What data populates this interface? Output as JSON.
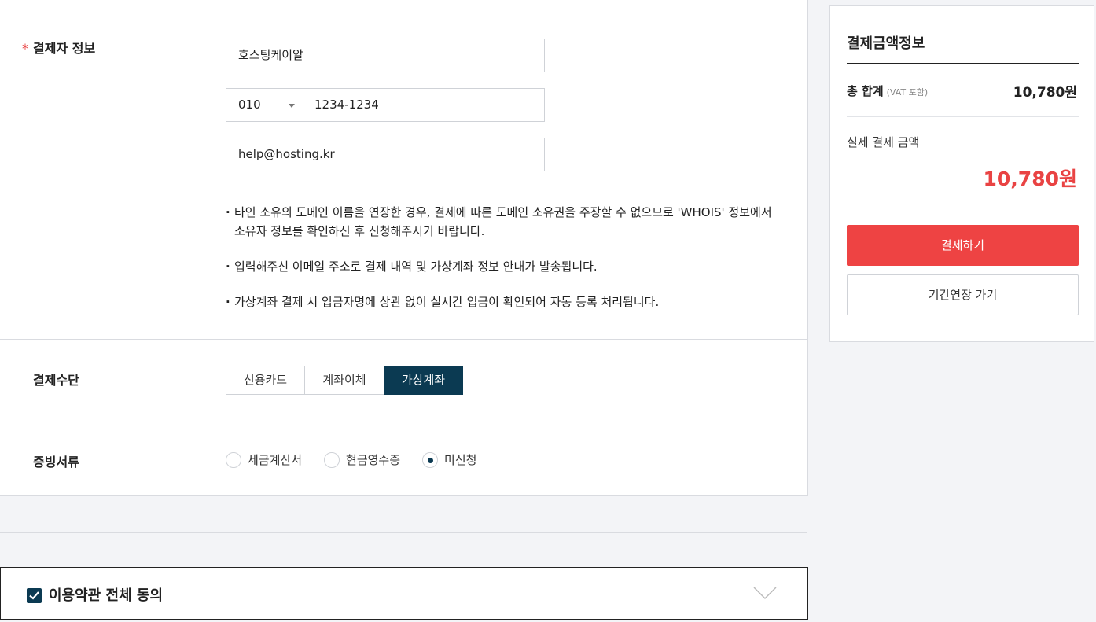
{
  "payer": {
    "label": "결제자 정보",
    "required_mark": "*",
    "name_value": "호스팅케이알",
    "phone_prefix": "010",
    "phone_number": "1234-1234",
    "email_value": "help@hosting.kr",
    "notes": [
      "타인 소유의 도메인 이름을 연장한 경우, 결제에 따른 도메인 소유권을 주장할 수 없으므로 'WHOIS' 정보에서 소유자 정보를 확인하신 후 신청해주시기 바랍니다.",
      "입력해주신 이메일 주소로 결제 내역 및 가상계좌 정보 안내가 발송됩니다.",
      "가상계좌 결제 시 입금자명에 상관 없이 실시간 입금이 확인되어 자동 등록 처리됩니다."
    ]
  },
  "method": {
    "label": "결제수단",
    "options": [
      "신용카드",
      "계좌이체",
      "가상계좌"
    ],
    "selected": "가상계좌"
  },
  "proof": {
    "label": "증빙서류",
    "options": [
      "세금계산서",
      "현금영수증",
      "미신청"
    ],
    "selected": "미신청"
  },
  "terms": {
    "label": "이용약관 전체 동의",
    "checked": true
  },
  "summary": {
    "title": "결제금액정보",
    "total_label": "총 합계",
    "vat_note": "(VAT 포함)",
    "total_value": "10,780원",
    "actual_label": "실제 결제 금액",
    "actual_value": "10,780원",
    "pay_button": "결제하기",
    "extend_button": "기간연장 가기"
  },
  "colors": {
    "accent_red": "#ee4343",
    "navy": "#0b3a52"
  }
}
